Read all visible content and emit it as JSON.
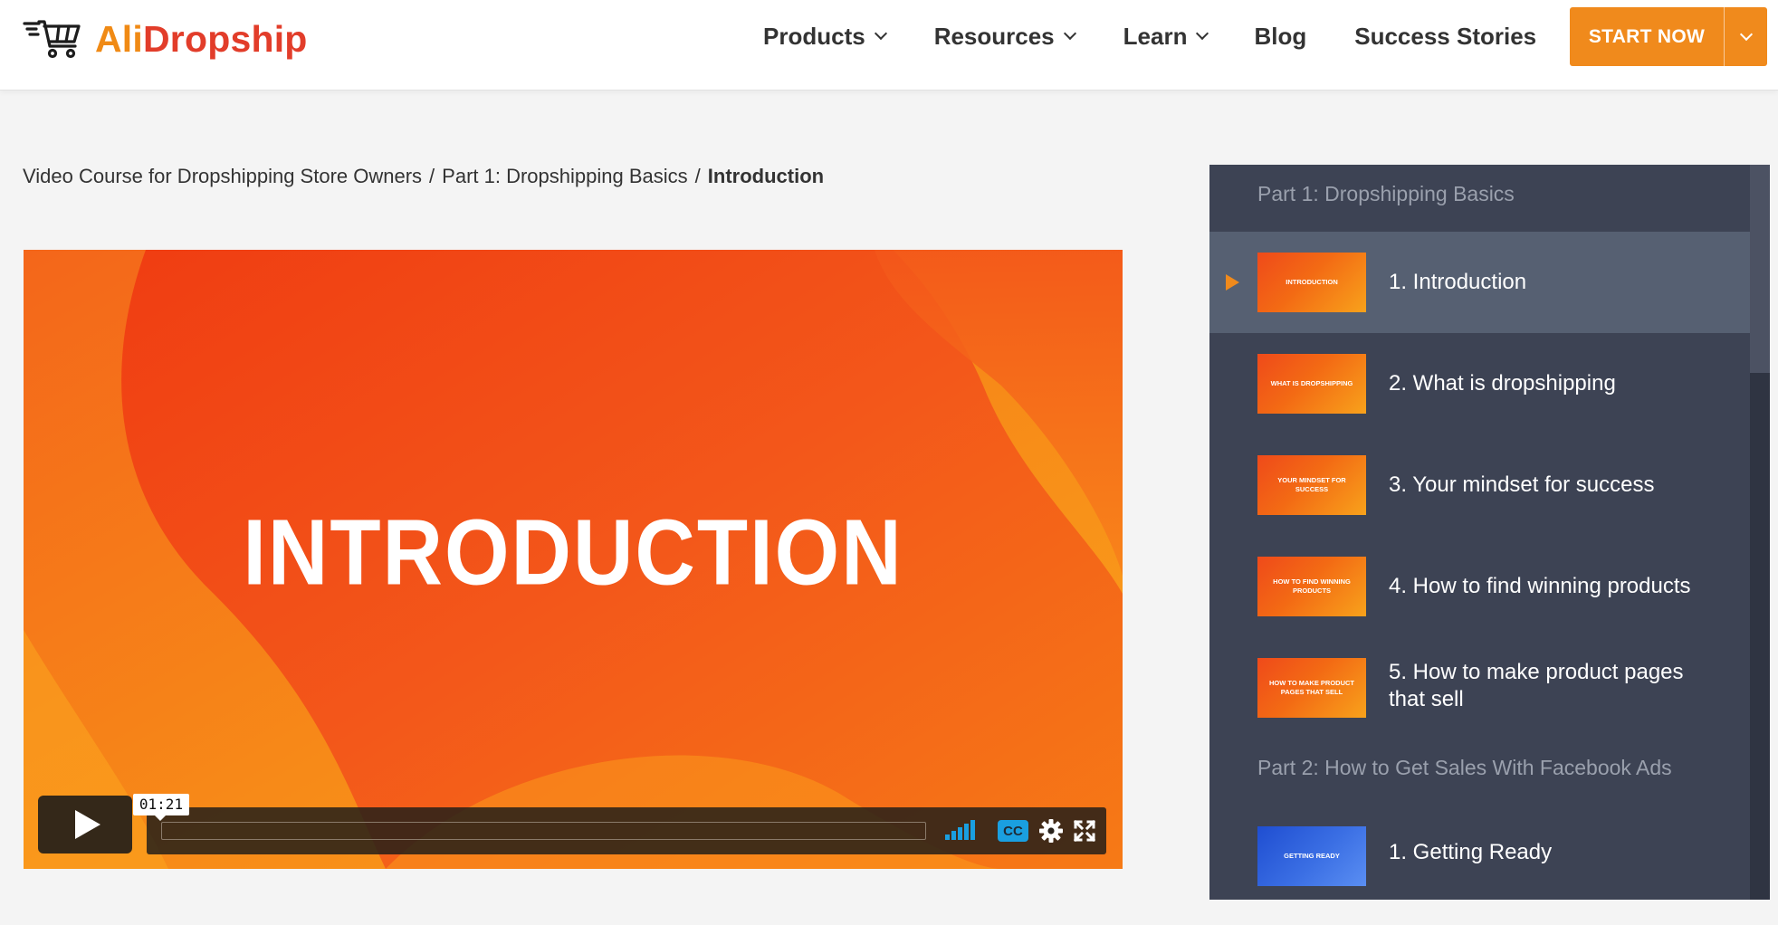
{
  "brand": {
    "logo_part1": "Ali",
    "logo_part2": "Dropship",
    "colors": {
      "orange": "#f08a15",
      "red": "#e23d2a"
    }
  },
  "nav": {
    "products": "Products",
    "resources": "Resources",
    "learn": "Learn",
    "blog": "Blog",
    "success_stories": "Success Stories",
    "cta_label": "START NOW"
  },
  "breadcrumb": {
    "course": "Video Course for Dropshipping Store Owners",
    "part": "Part 1: Dropshipping Basics",
    "current": "Introduction",
    "separator": "/"
  },
  "video": {
    "title_overlay": "INTRODUCTION",
    "timestamp": "01:21",
    "cc_label": "CC",
    "progress_fraction": 0
  },
  "sidebar": {
    "parts": [
      {
        "title": "Part 1: Dropshipping Basics",
        "lessons": [
          {
            "label": "1. Introduction",
            "thumb_text": "INTRODUCTION",
            "active": true
          },
          {
            "label": "2. What is dropshipping",
            "thumb_text": "WHAT IS DROPSHIPPING",
            "active": false
          },
          {
            "label": "3. Your mindset for success",
            "thumb_text": "YOUR MINDSET FOR SUCCESS",
            "active": false
          },
          {
            "label": "4. How to find winning products",
            "thumb_text": "HOW TO FIND WINNING PRODUCTS",
            "active": false
          },
          {
            "label": "5. How to make product pages that sell",
            "thumb_text": "HOW TO MAKE PRODUCT PAGES THAT SELL",
            "active": false
          }
        ]
      },
      {
        "title": "Part 2: How to Get Sales With Facebook Ads",
        "lessons": [
          {
            "label": "1. Getting Ready",
            "thumb_text": "GETTING READY",
            "active": false
          }
        ]
      }
    ]
  }
}
